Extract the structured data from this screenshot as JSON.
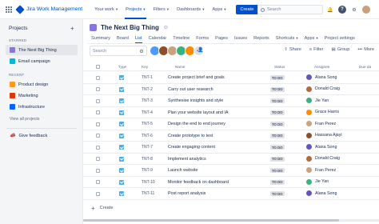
{
  "app": {
    "name": "Jira Work Management"
  },
  "topnav": {
    "items": [
      {
        "label": "Your work"
      },
      {
        "label": "Projects"
      },
      {
        "label": "Filters"
      },
      {
        "label": "Dashboards"
      },
      {
        "label": "Apps"
      }
    ],
    "create_label": "Create",
    "search_placeholder": "Search"
  },
  "sidebar": {
    "title": "Projects",
    "starred_label": "STARRED",
    "starred": [
      {
        "label": "The Next Big Thing",
        "color": "#8777d9"
      },
      {
        "label": "Email campaign",
        "color": "#00b8d9"
      }
    ],
    "recent_label": "RECENT",
    "recent": [
      {
        "label": "Product design",
        "color": "#ff991f"
      },
      {
        "label": "Marketing",
        "color": "#de350b"
      },
      {
        "label": "Infrastructure",
        "color": "#0065ff"
      }
    ],
    "view_all": "View all projects",
    "feedback": "Give feedback"
  },
  "project": {
    "name": "The Next Big Thing",
    "tabs": [
      "Summary",
      "Board",
      "List",
      "Calendar",
      "Timeline",
      "Forms",
      "Pages",
      "Issues",
      "Reports",
      "Shortcuts",
      "Apps",
      "Project settings"
    ],
    "active_tab": "List"
  },
  "toolbar": {
    "search_placeholder": "Search",
    "more_avatars": "+5",
    "share": "Share",
    "filter": "Filter",
    "group": "Group",
    "more": "More"
  },
  "table": {
    "headers": {
      "type": "Type",
      "key": "Key",
      "summary": "Name",
      "status": "Status",
      "assignee": "Assignee",
      "due": "Due da"
    },
    "rows": [
      {
        "key": "TNT-1",
        "summary": "Create project brief and goals",
        "status": "TO DO",
        "assignee": "Alana Song",
        "av": "#6554c0"
      },
      {
        "key": "TNT-2",
        "summary": "Carry out user research",
        "status": "TO DO",
        "assignee": "Donald Craig",
        "av": "#b06a3b"
      },
      {
        "key": "TNT-3",
        "summary": "Synthesise insights and style",
        "status": "TO DO",
        "assignee": "Jie Yan",
        "av": "#36b37e"
      },
      {
        "key": "TNT-4",
        "summary": "Plan your website layout and IA",
        "status": "TO DO",
        "assignee": "Grace Harris",
        "av": "#ff8b00"
      },
      {
        "key": "TNT-5",
        "summary": "Design the end to end journey",
        "status": "TO DO",
        "assignee": "Fran Perez",
        "av": "#c9a27e"
      },
      {
        "key": "TNT-6",
        "summary": "Create prototype to test",
        "status": "TO DO",
        "assignee": "Hassana Ajayi",
        "av": "#8d4e2a"
      },
      {
        "key": "TNT-7",
        "summary": "Create engaging content",
        "status": "TO DO",
        "assignee": "Alana Song",
        "av": "#6554c0"
      },
      {
        "key": "TNT-8",
        "summary": "Implement analytics",
        "status": "TO DO",
        "assignee": "Donald Craig",
        "av": "#b06a3b"
      },
      {
        "key": "TNT-9",
        "summary": "Launch website",
        "status": "TO DO",
        "assignee": "Fran Perez",
        "av": "#c9a27e"
      },
      {
        "key": "TNT-10",
        "summary": "Monitor feedback on dashboard",
        "status": "TO DO",
        "assignee": "Jie Yan",
        "av": "#36b37e"
      },
      {
        "key": "TNT-11",
        "summary": "Post report analysis",
        "status": "TO DO",
        "assignee": "Alana Song",
        "av": "#6554c0"
      }
    ],
    "create_label": "Create"
  },
  "colors": {
    "brand": "#0052cc",
    "sidebar_bg": "#f4f5f7",
    "status_bg": "#dfe1e6"
  }
}
